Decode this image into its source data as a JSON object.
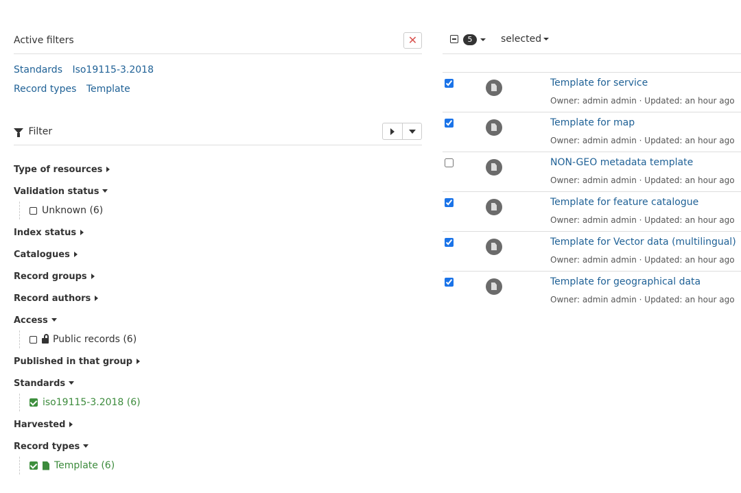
{
  "active_filters": {
    "title": "Active filters",
    "close_label": "✕",
    "items": [
      {
        "facet": "Standards",
        "value": "Iso19115-3.2018"
      },
      {
        "facet": "Record types",
        "value": "Template"
      }
    ]
  },
  "filter": {
    "title": "Filter",
    "facets": [
      {
        "label": "Type of resources"
      },
      {
        "label": "Validation status",
        "expanded": true
      },
      {
        "label": "Unknown (6)"
      },
      {
        "label": "Index status"
      },
      {
        "label": "Catalogues"
      },
      {
        "label": "Record groups"
      },
      {
        "label": "Record authors"
      },
      {
        "label": "Access",
        "expanded": true
      },
      {
        "label": "Public records (6)"
      },
      {
        "label": "Published in that group"
      },
      {
        "label": "Standards",
        "expanded": true
      },
      {
        "label": "iso19115-3.2018 (6)"
      },
      {
        "label": "Harvested"
      },
      {
        "label": "Record types",
        "expanded": true
      },
      {
        "label": "Template (6)"
      }
    ]
  },
  "toolbar": {
    "selected_count": "5",
    "selected_label": "selected"
  },
  "results": [
    {
      "title": "Template for service",
      "meta": "Owner: admin admin · Updated: an hour ago",
      "checked": true
    },
    {
      "title": "Template for map",
      "meta": "Owner: admin admin · Updated: an hour ago",
      "checked": true
    },
    {
      "title": "NON-GEO metadata template",
      "meta": "Owner: admin admin · Updated: an hour ago",
      "checked": false
    },
    {
      "title": "Template for feature catalogue",
      "meta": "Owner: admin admin · Updated: an hour ago",
      "checked": true
    },
    {
      "title": "Template for Vector data (multilingual)",
      "meta": "Owner: admin admin · Updated: an hour ago",
      "checked": true
    },
    {
      "title": "Template for geographical data",
      "meta": "Owner: admin admin · Updated: an hour ago",
      "checked": true
    }
  ]
}
